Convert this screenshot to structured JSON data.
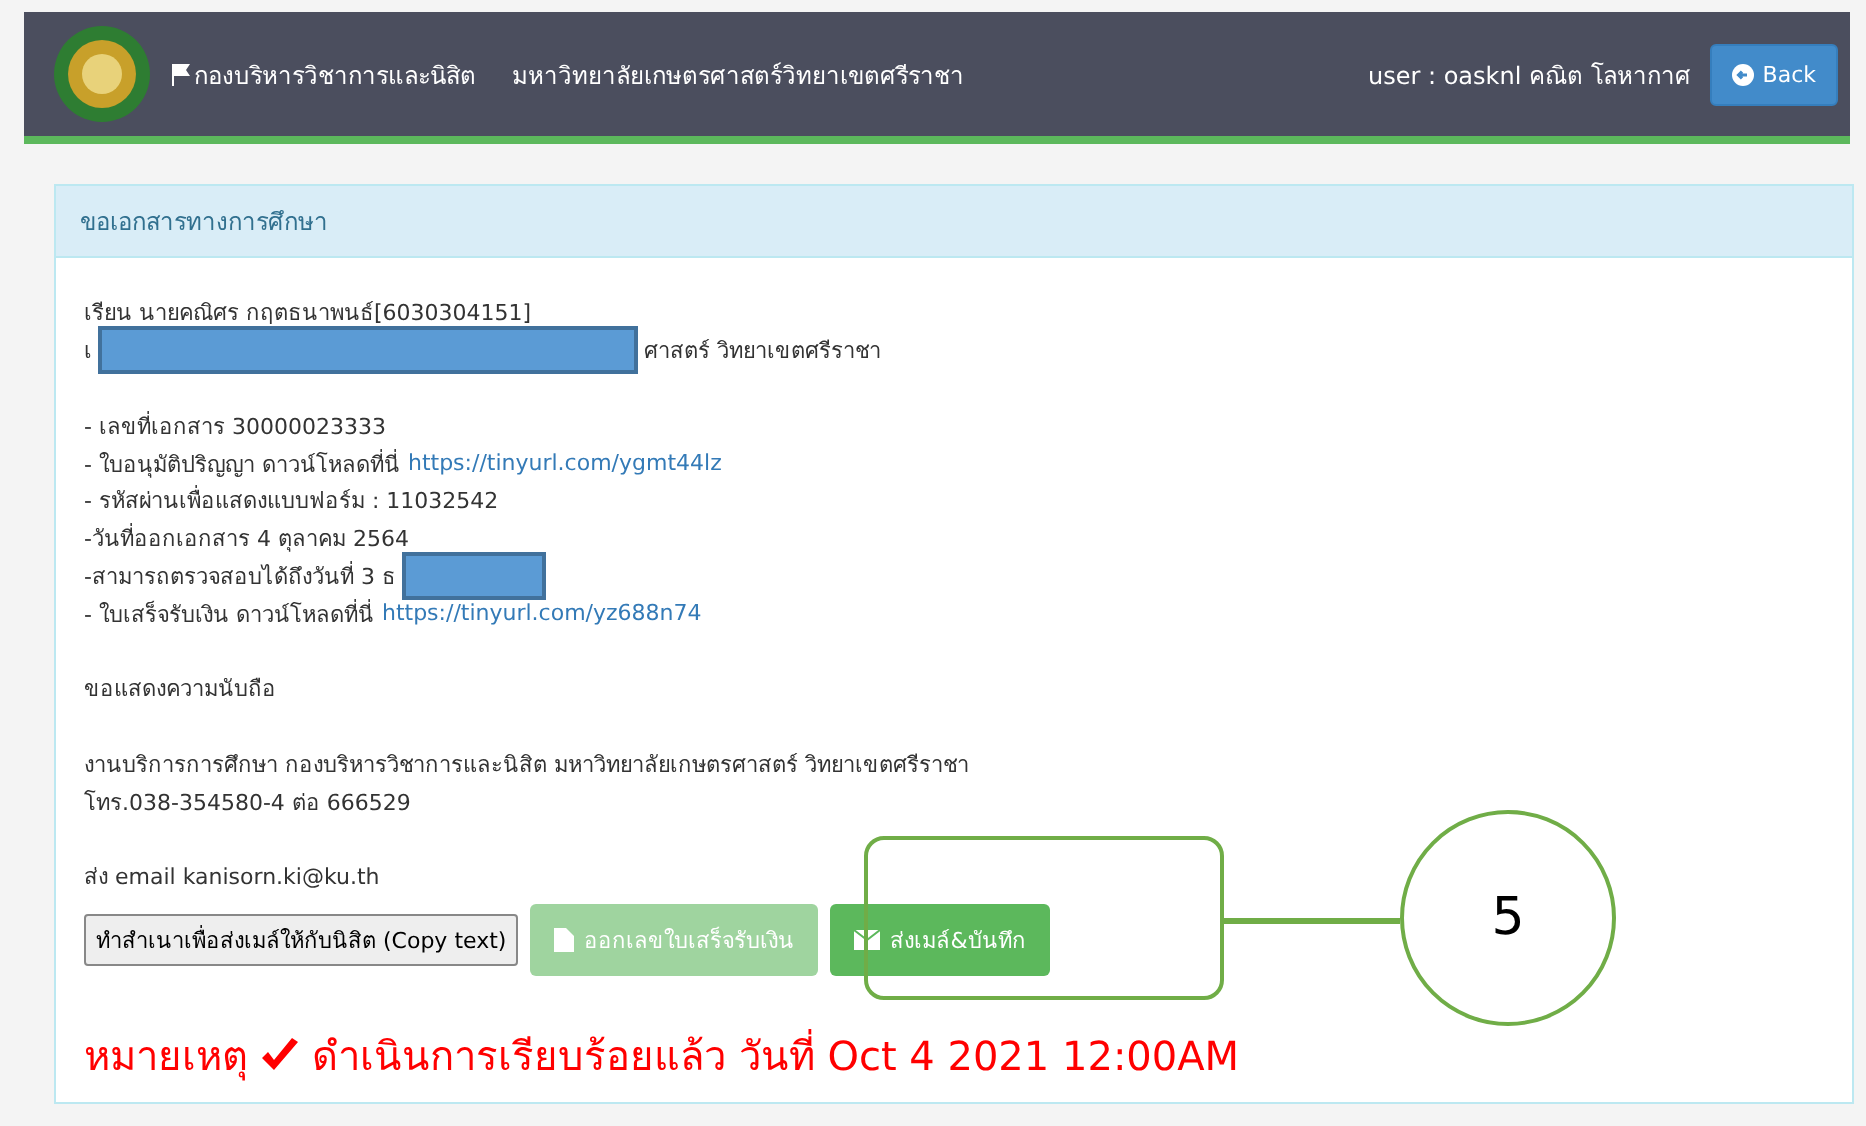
{
  "header": {
    "title": "กองบริหารวิชาการและนิสิต",
    "subtitle": "มหาวิทยาลัยเกษตรศาสตร์วิทยาเขตศรีราชา",
    "user": "user : oasknl คณิต โลหากาศ",
    "back": "Back"
  },
  "panel": {
    "title": "ขอเอกสารทางการศึกษา"
  },
  "letter": [
    {
      "kind": "text",
      "text": "เรียน นายคณิศร กฤตธนาพนธ์[6030304151]"
    },
    {
      "kind": "redacted",
      "before": "เ",
      "after": "ศาสตร์ วิทยาเขตศรีราชา"
    },
    {
      "kind": "gap"
    },
    {
      "kind": "text",
      "text": "- เลขที่เอกสาร 30000023333"
    },
    {
      "kind": "link",
      "text": "- ใบอนุมัติปริญญา ดาวน์โหลดที่นี่",
      "link": "https://tinyurl.com/ygmt44lz"
    },
    {
      "kind": "text",
      "text": "- รหัสผ่านเพื่อแสดงแบบฟอร์ม : 11032542"
    },
    {
      "kind": "text",
      "text": "-วันที่ออกเอกสาร 4 ตุลาคม 2564"
    },
    {
      "kind": "redacted",
      "before": "-สามารถตรวจสอบได้ถึงวันที่ 3 ธ"
    },
    {
      "kind": "link",
      "text": "- ใบเสร็จรับเงิน ดาวน์โหลดที่นี่",
      "link": "https://tinyurl.com/yz688n74"
    },
    {
      "kind": "gap"
    },
    {
      "kind": "text",
      "text": "ขอแสดงความนับถือ"
    },
    {
      "kind": "gap"
    },
    {
      "kind": "text",
      "text": "งานบริการการศึกษา กองบริหารวิชาการและนิสิต มหาวิทยาลัยเกษตรศาสตร์ วิทยาเขตศรีราชา"
    },
    {
      "kind": "text",
      "text": "โทร.038-354580-4 ต่อ 666529"
    },
    {
      "kind": "gap"
    },
    {
      "kind": "text",
      "text": "ส่ง email kanisorn.ki@ku.th"
    }
  ],
  "buttons": [
    {
      "kind": "plain",
      "label": "ทำสำเนาเพื่อส่งเมล์ให้กับนิสิต (Copy text)",
      "disabled": false
    },
    {
      "kind": "file",
      "label": "ออกเลขใบเสร็จรับเงิน",
      "disabled": true
    },
    {
      "kind": "mail",
      "label": "ส่งเมล์&บันทึก",
      "disabled": false
    }
  ],
  "note": {
    "label": "หมายเหตุ",
    "text": "ดำเนินการเรียบร้อยแล้ว วันที่ Oct 4 2021 12:00AM"
  },
  "callout": {
    "number": "5"
  }
}
